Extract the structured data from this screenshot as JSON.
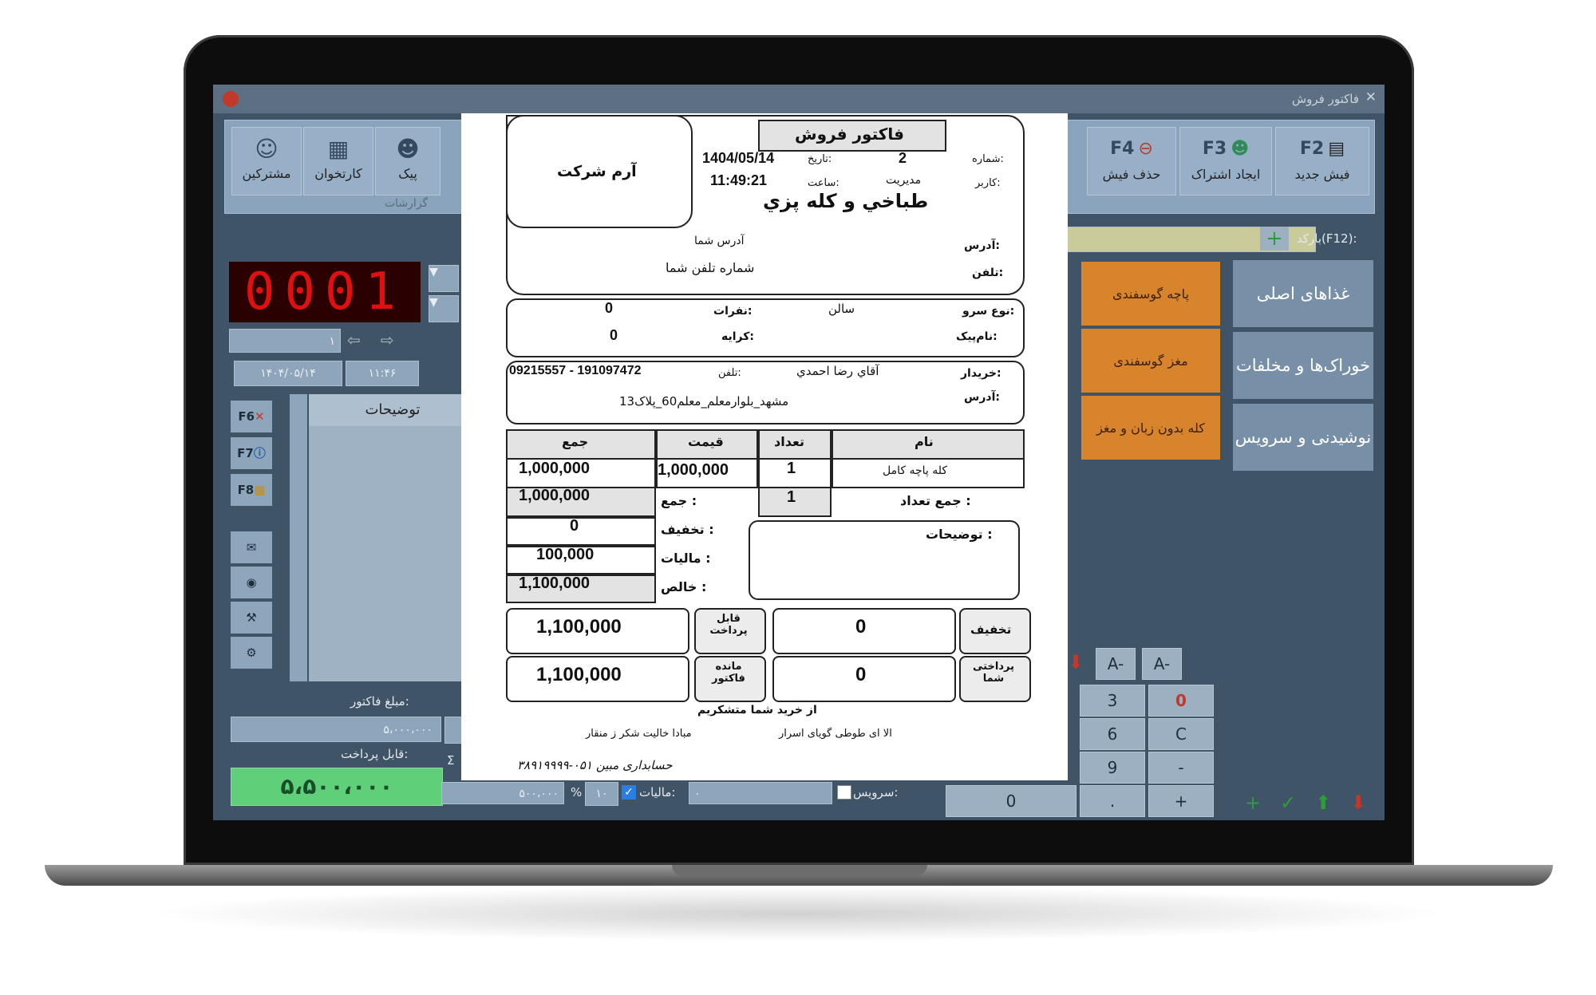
{
  "window": {
    "title": "فاکتور فروش"
  },
  "ribbon": {
    "left_buttons": [
      {
        "label": "مشترکین",
        "icon": "people-icon"
      },
      {
        "label": "کارتخوان",
        "icon": "card-reader-icon"
      },
      {
        "label": "پیک",
        "icon": "courier-icon"
      }
    ],
    "left_group_label": "گزارشات",
    "right_buttons": [
      {
        "key": "F4",
        "label": "حذف فیش",
        "icon": "delete-receipt-icon"
      },
      {
        "key": "F3",
        "label": "ایجاد اشتراک",
        "icon": "add-user-icon"
      },
      {
        "key": "F2",
        "label": "فیش جدید",
        "icon": "new-receipt-icon"
      }
    ]
  },
  "barcode": {
    "label": "بارکد(F12):"
  },
  "order_number": "0001",
  "date_field": "۱۴۰۴/۰۵/۱۴",
  "time_field": "۱۱:۴۶",
  "page_field": "۱",
  "grid": {
    "header": "توضیحات"
  },
  "side_keys": [
    "F6",
    "F7",
    "F8"
  ],
  "totals": {
    "invoice_label": "مبلغ فاکتور:",
    "invoice_value": "۵،۰۰۰،۰۰۰",
    "payable_label": "قابل پرداخت:",
    "payable_value": "۵،۵۰۰،۰۰۰",
    "tax_label": "مالیات:",
    "tax_percent": "۱۰",
    "percent_sign": "%",
    "tax_value": "۵۰۰،۰۰۰",
    "service_label": "سرویس:",
    "service_value": "۰",
    "sigma": "Σ"
  },
  "categories": [
    "غذاهای اصلی",
    "خوراک‌ها و مخلفات",
    "نوشیدنی و سرویس"
  ],
  "menu_items": [
    "پاچه گوسفندی",
    "مغز گوسفندی",
    "کله بدون زبان و مغز"
  ],
  "keypad": {
    "rows": [
      [
        "3",
        "0"
      ],
      [
        "6",
        "C"
      ],
      [
        "9",
        "-"
      ],
      [
        ".",
        "+"
      ]
    ],
    "zero": "0",
    "font_buttons": [
      "A-",
      "A-"
    ]
  },
  "receipt": {
    "title": "فاکتور فروش",
    "company": "آرم شرکت",
    "number_label": "شماره:",
    "number": "2",
    "date_label": "تاریخ:",
    "date": "1404/05/14",
    "user_label": "کاربر:",
    "user": "مدیریت",
    "time_label": "ساعت:",
    "time": "11:49:21",
    "shop_name": "طباخي و كله پزي",
    "address_label": "آدرس:",
    "address": "آدرس شما",
    "phone_label": "تلفن:",
    "phone": "شماره تلفن شما",
    "service_type_label": "نوع سرو:",
    "service_type": "سالن",
    "tables_label": "نفرات:",
    "tables": "0",
    "courier_label": "نام‌پیک:",
    "fare_label": "کرایه:",
    "fare": "0",
    "buyer_label": "خریدار:",
    "buyer": "آقاي رضا احمدي",
    "buyer_phone_label": "تلفن:",
    "buyer_phone": "09215557 - 191097472",
    "buyer_address_label": "آدرس:",
    "buyer_address": "مشهد_بلوارمعلم_معلم60_پلاک13",
    "table": {
      "headers": [
        "نام",
        "تعداد",
        "قیمت",
        "جمع"
      ],
      "rows": [
        [
          "کله پاچه کامل",
          "1",
          "1,000,000",
          "1,000,000"
        ]
      ]
    },
    "sum_count_label": "جمع تعداد :",
    "sum_count": "1",
    "sum_label": "جمع :",
    "sum": "1,000,000",
    "discount_label": "تخفیف :",
    "discount": "0",
    "tax_label": "مالیات :",
    "tax": "100,000",
    "net_label": "خالص :",
    "net": "1,100,000",
    "notes_label": "توضیحات :",
    "discount_box_label": "تخفیف",
    "discount_box_value": "0",
    "payable_box_label": "قابل پرداخت",
    "payable_box_value": "1,100,000",
    "paid_box_label": "پرداختی شما",
    "paid_box_value": "0",
    "remaining_box_label": "مانده فاکتور",
    "remaining_box_value": "1,100,000",
    "thanks": "از خرید شما متشکریم",
    "footer_left": "مبادا خالیت شکر ز منقار",
    "footer_right": "الا ای طوطی گویای اسرار",
    "signature": "حسابداری مبین ۰۵۱-۳۸۹۱۹۹۹۹"
  }
}
